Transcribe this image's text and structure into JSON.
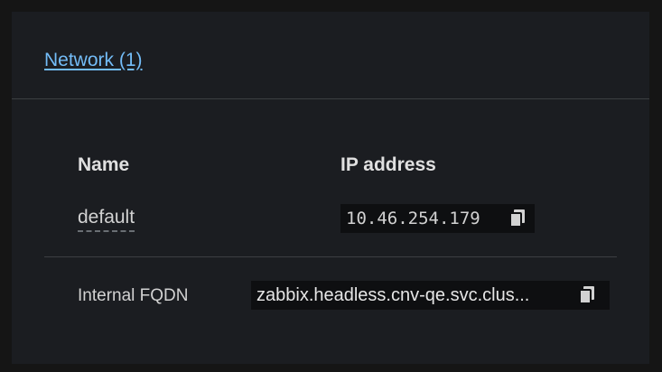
{
  "card": {
    "network_link": "Network (1)"
  },
  "table": {
    "headers": {
      "name": "Name",
      "ip": "IP address"
    },
    "rows": [
      {
        "name": "default",
        "ip": "10.46.254.179"
      }
    ]
  },
  "fqdn": {
    "label": "Internal FQDN",
    "value": "zabbix.headless.cnv-qe.svc.clus..."
  },
  "icons": {
    "copy": "copy-icon"
  },
  "colors": {
    "link": "#73bcf7",
    "background": "#1b1d21",
    "code_background": "#0e0f11"
  }
}
